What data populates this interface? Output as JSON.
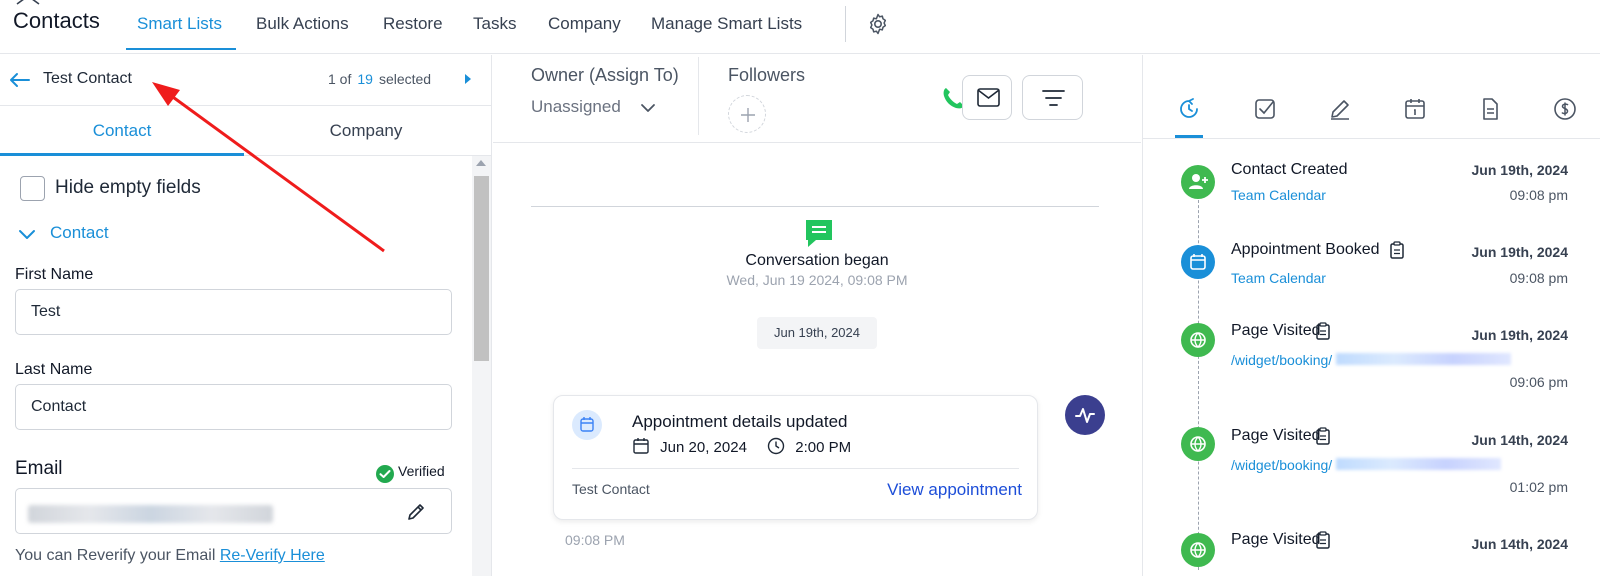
{
  "app": {
    "title": "Contacts"
  },
  "nav": {
    "items": [
      {
        "label": "Smart Lists",
        "active": true
      },
      {
        "label": "Bulk Actions"
      },
      {
        "label": "Restore"
      },
      {
        "label": "Tasks"
      },
      {
        "label": "Company"
      },
      {
        "label": "Manage Smart Lists"
      }
    ]
  },
  "contact_header": {
    "name": "Test Contact",
    "pager_prefix": "1 of",
    "pager_total": "19",
    "pager_suffix": "selected"
  },
  "left_tabs": [
    {
      "label": "Contact",
      "active": true
    },
    {
      "label": "Company"
    }
  ],
  "form": {
    "hide_empty_label": "Hide empty fields",
    "section_label": "Contact",
    "first_name_label": "First Name",
    "first_name_value": "Test",
    "last_name_label": "Last Name",
    "last_name_value": "Contact",
    "email_label": "Email",
    "email_verified": "Verified",
    "reverify_text": "You can Reverify your Email",
    "reverify_link": "Re-Verify Here"
  },
  "owner": {
    "label": "Owner (Assign To)",
    "value": "Unassigned"
  },
  "followers": {
    "label": "Followers"
  },
  "conversation": {
    "began_title": "Conversation began",
    "began_date": "Wed, Jun 19 2024, 09:08 PM",
    "date_chip": "Jun 19th, 2024",
    "card": {
      "title": "Appointment details updated",
      "date": "Jun 20, 2024",
      "time": "2:00 PM",
      "contact": "Test Contact",
      "link": "View appointment"
    },
    "card_timestamp": "09:08 PM"
  },
  "timeline": [
    {
      "title": "Contact Created",
      "sub": "Team Calendar",
      "date": "Jun 19th, 2024",
      "time": "09:08 pm",
      "color": "#3fb950",
      "icon": "user-plus-icon"
    },
    {
      "title": "Appointment Booked",
      "sub": "Team Calendar",
      "date": "Jun 19th, 2024",
      "time": "09:08 pm",
      "color": "#1a8fd8",
      "icon": "calendar-icon"
    },
    {
      "title": "Page Visited",
      "sub": "/widget/booking/",
      "date": "Jun 19th, 2024",
      "time": "09:06 pm",
      "color": "#3fb950",
      "icon": "globe-icon"
    },
    {
      "title": "Page Visited",
      "sub": "/widget/booking/",
      "date": "Jun 14th, 2024",
      "time": "01:02 pm",
      "color": "#3fb950",
      "icon": "globe-icon"
    },
    {
      "title": "Page Visited",
      "sub": "",
      "date": "Jun 14th, 2024",
      "time": "",
      "color": "#3fb950",
      "icon": "globe-icon"
    }
  ],
  "colors": {
    "accent": "#1a8fd8",
    "success": "#3fb950",
    "annotation_arrow": "#ef1c1c"
  }
}
